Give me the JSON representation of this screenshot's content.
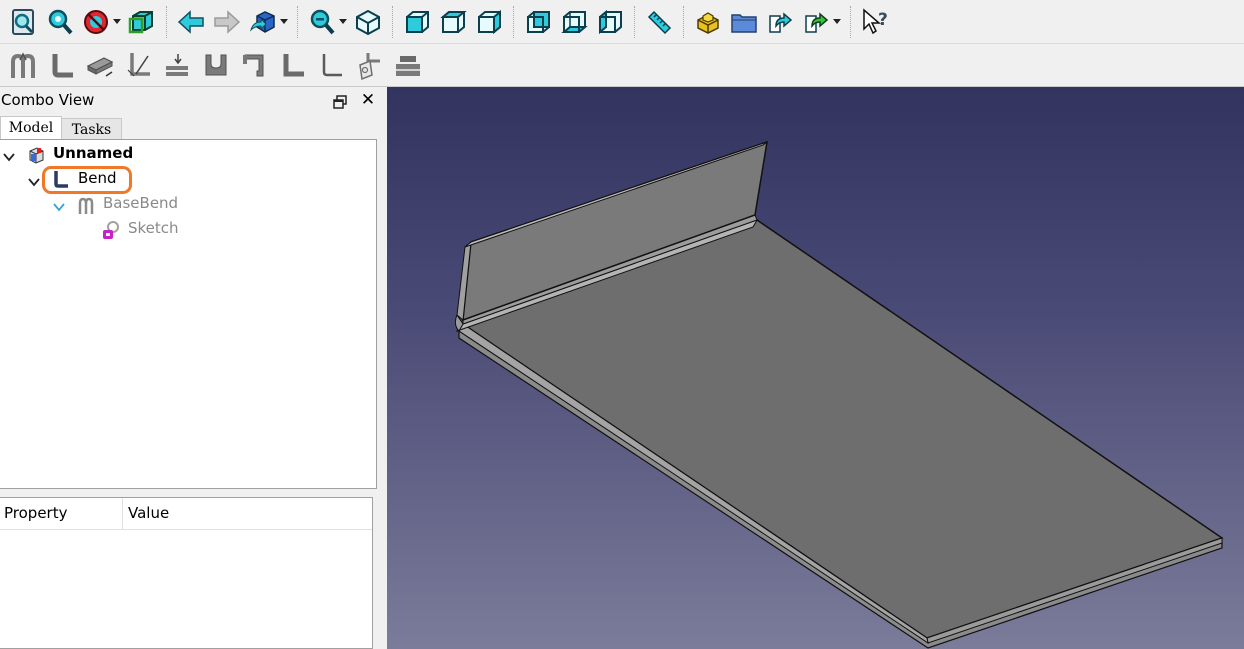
{
  "toolbar": {
    "row1_icons": [
      "fit-all-icon",
      "fit-selection-icon",
      "draw-style-icon",
      "bounding-box-icon",
      "back-arrow-icon",
      "forward-arrow-icon",
      "workbench-box-icon",
      "zoom-icon",
      "isometric-view-icon",
      "front-view-icon",
      "top-view-icon",
      "right-view-icon",
      "rear-view-icon",
      "bottom-view-icon",
      "left-view-icon",
      "measure-ruler-icon",
      "part-icon",
      "folder-icon",
      "link-icon",
      "link-actions-icon",
      "whats-this-icon"
    ],
    "row2_icons": [
      "base-bend-icon",
      "bend-icon",
      "extrude-icon",
      "junction-icon",
      "relief-icon",
      "u-profile-icon",
      "hem-icon",
      "l-profile-icon",
      "corner-bend-icon",
      "unfold-icon",
      "flange-tool-icon"
    ]
  },
  "combo": {
    "title": "Combo View",
    "tabs": [
      "Model",
      "Tasks"
    ],
    "active_tab": "Model"
  },
  "tree": {
    "items": [
      {
        "label": "Unnamed",
        "icon": "document-icon",
        "expanded": true,
        "bold": true,
        "dim": false
      },
      {
        "label": "Bend",
        "icon": "bend-icon",
        "expanded": true,
        "bold": false,
        "dim": false,
        "highlighted": true
      },
      {
        "label": "BaseBend",
        "icon": "base-bend-icon",
        "expanded": true,
        "bold": false,
        "dim": true
      },
      {
        "label": "Sketch",
        "icon": "sketch-icon",
        "expanded": false,
        "bold": false,
        "dim": true
      }
    ]
  },
  "properties": {
    "columns": [
      "Property",
      "Value"
    ]
  },
  "colors": {
    "highlight": "#f07828",
    "viewport_top": "#33335f",
    "viewport_bottom": "#7b7b9a",
    "part_face": "#6e6e6e",
    "toolbar_accent": "#1fb8c8"
  }
}
